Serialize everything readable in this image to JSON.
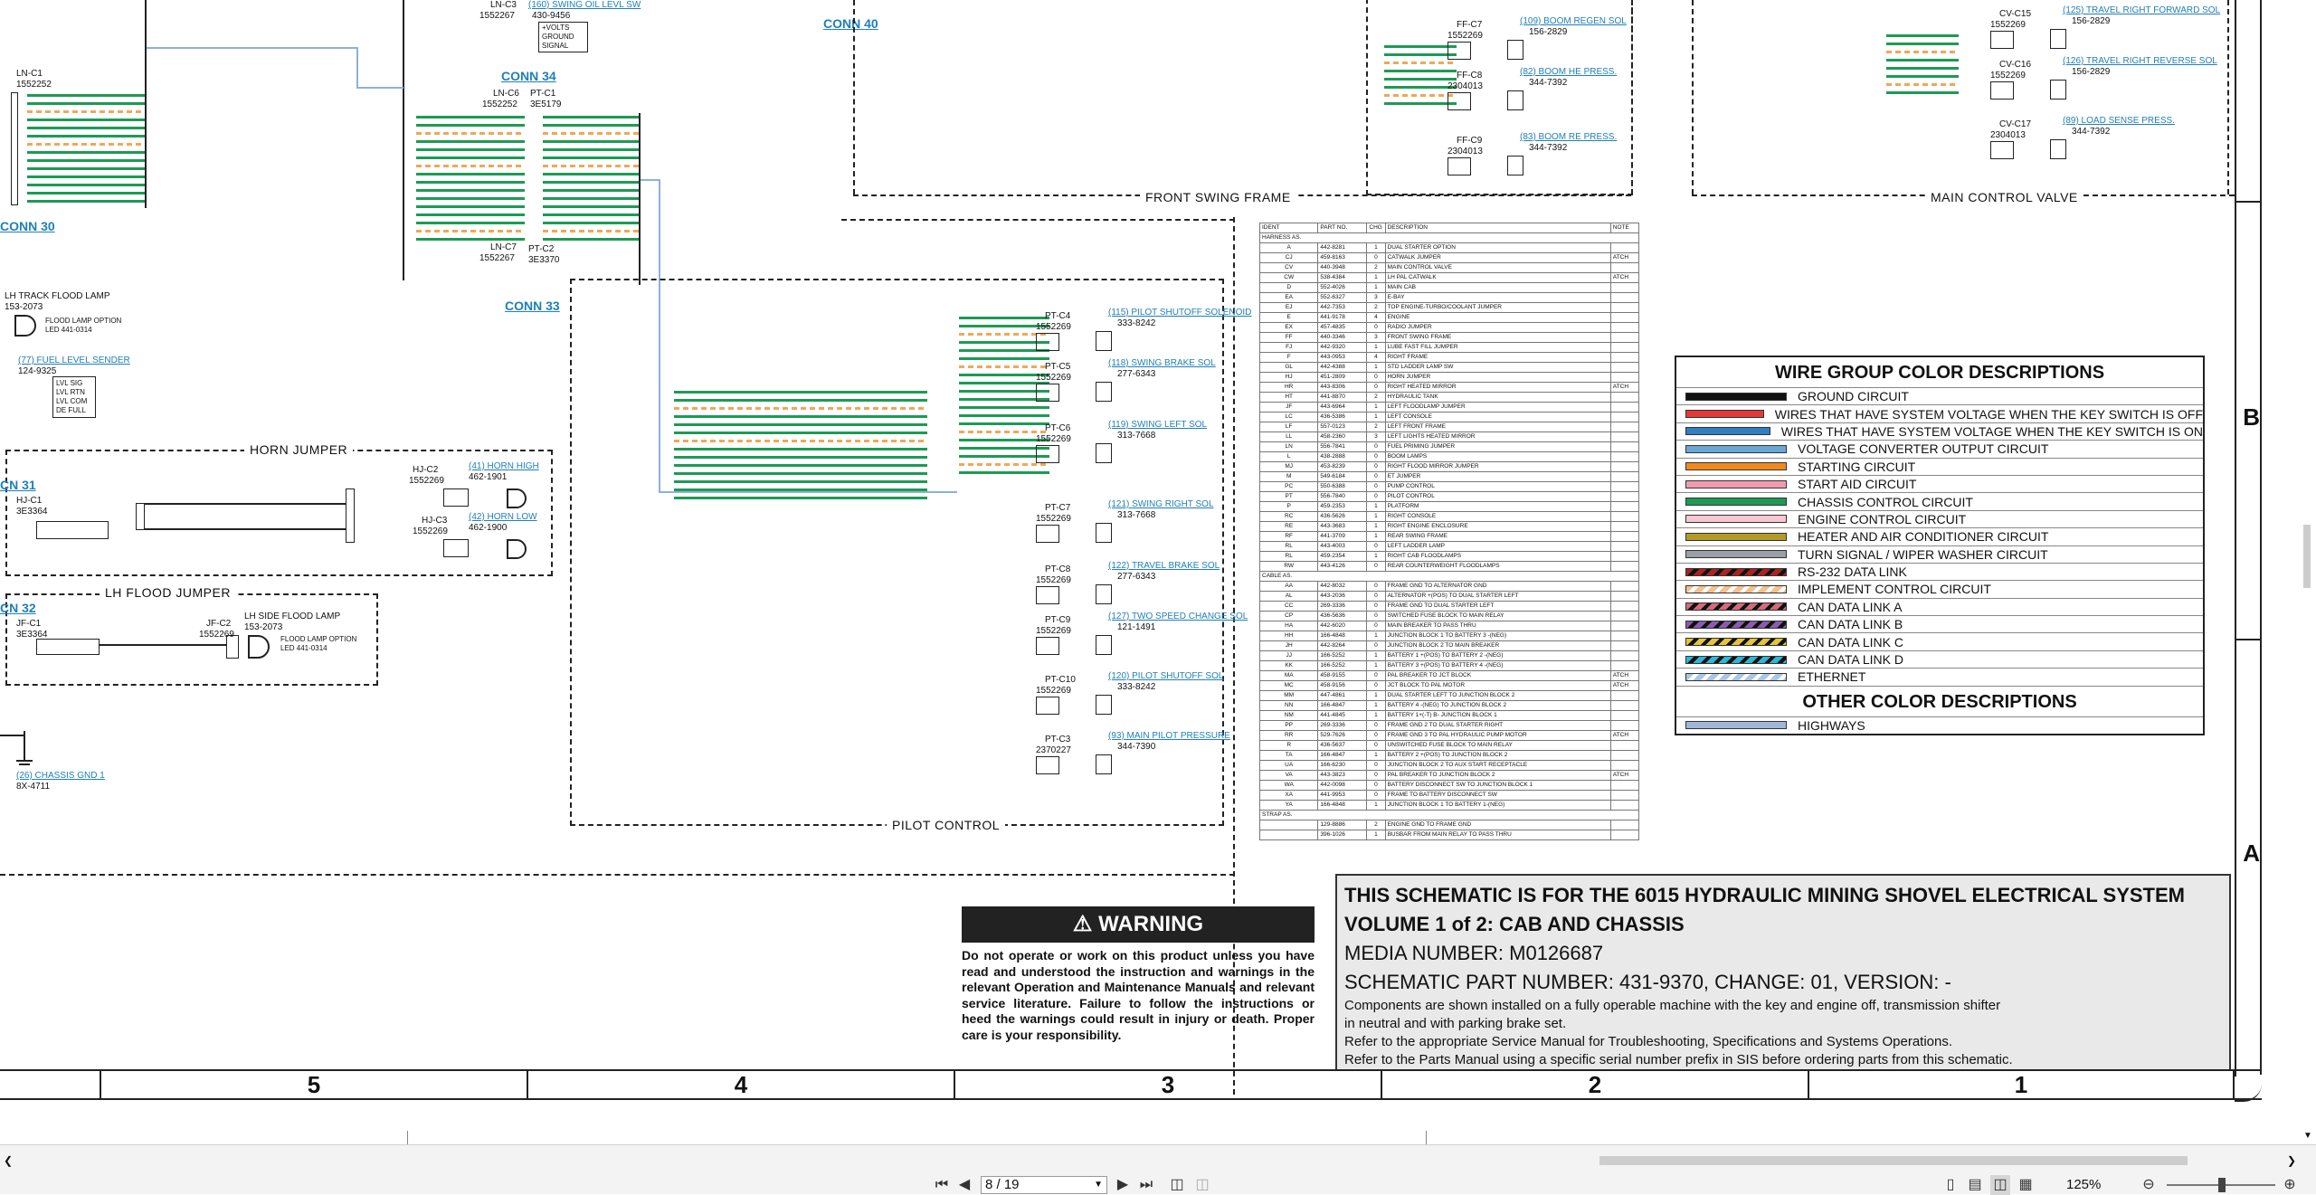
{
  "schematic": {
    "connectors": {
      "conn30": "CONN 30",
      "conn31": "CN 31",
      "conn32": "CN 32",
      "conn33": "CONN 33",
      "conn34": "CONN 34",
      "conn40": "CONN 40"
    },
    "top_left": {
      "lnc1": "LN-C1",
      "lnc1_part": "1552252",
      "lnc3": "LN-C3",
      "lnc3_part": "1552267",
      "swing_oil": "(160) SWING OIL LEVL SW",
      "swing_oil_part": "430-9456",
      "lnc6": "LN-C6",
      "lnc6_part": "1552252",
      "ptc1": "PT-C1",
      "ptc1_part": "3E5179",
      "lnc7": "LN-C7",
      "lnc7_part": "1552267",
      "ptc2": "PT-C2",
      "ptc2_part": "3E3370",
      "swing_oil_pins": [
        "+VOLTS",
        "GROUND",
        "SIGNAL"
      ]
    },
    "left_lamps": {
      "track_lamp": "LH TRACK FLOOD LAMP",
      "track_lamp_part": "153-2073",
      "flood_lamp_option": "FLOOD LAMP OPTION",
      "flood_led": "LED 441-0314",
      "fuel_sender": "(77) FUEL LEVEL SENDER",
      "fuel_sender_part": "124-9325",
      "fuel_pins": [
        "LVL SIG",
        "LVL RTN",
        "LVL COM",
        "DE FULL"
      ]
    },
    "horn": {
      "title": "HORN JUMPER",
      "hjc1": "HJ-C1",
      "hjc1_part": "3E3364",
      "hjc2": "HJ-C2",
      "hjc2_part": "1552269",
      "hjc3": "HJ-C3",
      "hjc3_part": "1552269",
      "horn_high": "(41) HORN HIGH",
      "horn_high_part": "462-1901",
      "horn_low": "(42) HORN LOW",
      "horn_low_part": "462-1900"
    },
    "flood": {
      "title": "LH FLOOD JUMPER",
      "jfc1": "JF-C1",
      "jfc1_part": "3E3364",
      "jfc2": "JF-C2",
      "jfc2_part": "1552269",
      "side_lamp": "LH SIDE FLOOD LAMP",
      "side_lamp_part": "153-2073",
      "option": "FLOOD LAMP OPTION",
      "led": "LED 441-0314",
      "chassis_gnd": "(26) CHASSIS GND 1",
      "chassis_gnd_part": "8X-4711"
    },
    "pilot": {
      "title": "PILOT CONTROL",
      "items": [
        {
          "id": "PT-C4",
          "part": "1552269",
          "name": "(115) PILOT SHUTOFF SOLENOID",
          "num": "333-8242"
        },
        {
          "id": "PT-C5",
          "part": "1552269",
          "name": "(118) SWING BRAKE SOL",
          "num": "277-6343"
        },
        {
          "id": "PT-C6",
          "part": "1552269",
          "name": "(119) SWING LEFT SOL",
          "num": "313-7668"
        },
        {
          "id": "PT-C7",
          "part": "1552269",
          "name": "(121) SWING RIGHT SOL",
          "num": "313-7668"
        },
        {
          "id": "PT-C8",
          "part": "1552269",
          "name": "(122) TRAVEL BRAKE SOL",
          "num": "277-6343"
        },
        {
          "id": "PT-C9",
          "part": "1552269",
          "name": "(127) TWO SPEED CHANGE SOL",
          "num": "121-1491"
        },
        {
          "id": "PT-C10",
          "part": "1552269",
          "name": "(120) PILOT SHUTOFF SOL",
          "num": "333-8242"
        },
        {
          "id": "PT-C3",
          "part": "2370227",
          "name": "(93) MAIN PILOT PRESSURE",
          "num": "344-7390"
        }
      ]
    },
    "front_swing": {
      "title": "FRONT SWING FRAME",
      "items": [
        {
          "id": "FF-C7",
          "part": "1552269",
          "name": "(109) BOOM REGEN SOL",
          "num": "156-2829"
        },
        {
          "id": "FF-C8",
          "part": "2304013",
          "name": "(82) BOOM HE PRESS.",
          "num": "344-7392"
        },
        {
          "id": "FF-C9",
          "part": "2304013",
          "name": "(83) BOOM RE PRESS.",
          "num": "344-7392"
        }
      ]
    },
    "main_valve": {
      "title": "MAIN CONTROL VALVE",
      "items": [
        {
          "id": "CV-C15",
          "part": "1552269",
          "name": "(125) TRAVEL RIGHT FORWARD SOL",
          "num": "156-2829"
        },
        {
          "id": "CV-C16",
          "part": "1552269",
          "name": "(126) TRAVEL RIGHT REVERSE SOL",
          "num": "156-2829"
        },
        {
          "id": "CV-C17",
          "part": "2304013",
          "name": "(89) LOAD SENSE PRESS.",
          "num": "344-7392"
        }
      ]
    }
  },
  "parts_table": {
    "headers": [
      "IDENT",
      "PART NO.",
      "CHG",
      "DESCRIPTION",
      "NOTE"
    ],
    "group_harness": "HARNESS AS.",
    "harness_rows": [
      [
        "A",
        "442-8281",
        "1",
        "DUAL STARTER OPTION",
        ""
      ],
      [
        "CJ",
        "459-8163",
        "0",
        "CATWALK JUMPER",
        "ATCH"
      ],
      [
        "CV",
        "440-3948",
        "2",
        "MAIN CONTROL VALVE",
        ""
      ],
      [
        "CW",
        "538-4384",
        "1",
        "LH PAL CATWALK",
        "ATCH"
      ],
      [
        "D",
        "552-4026",
        "1",
        "MAIN CAB",
        ""
      ],
      [
        "EA",
        "552-6327",
        "3",
        "E-BAY",
        ""
      ],
      [
        "EJ",
        "442-7353",
        "2",
        "TOP ENGINE-TURBO/COOLANT JUMPER",
        ""
      ],
      [
        "E",
        "441-9178",
        "4",
        "ENGINE",
        ""
      ],
      [
        "EX",
        "457-4835",
        "0",
        "RADIO JUMPER",
        ""
      ],
      [
        "FF",
        "440-3346",
        "3",
        "FRONT SWING FRAME",
        ""
      ],
      [
        "FJ",
        "442-9320",
        "1",
        "LUBE FAST FILL JUMPER",
        ""
      ],
      [
        "F",
        "443-0953",
        "4",
        "RIGHT FRAME",
        ""
      ],
      [
        "GL",
        "442-4388",
        "1",
        "STD LADDER LAMP SW",
        ""
      ],
      [
        "HJ",
        "451-2809",
        "0",
        "HORN JUMPER",
        ""
      ],
      [
        "HR",
        "443-8306",
        "0",
        "RIGHT HEATED MIRROR",
        "ATCH"
      ],
      [
        "HT",
        "441-8870",
        "2",
        "HYDRAULIC TANK",
        ""
      ],
      [
        "JF",
        "443-6964",
        "1",
        "LEFT FLOODLAMP JUMPER",
        ""
      ],
      [
        "LC",
        "436-5386",
        "1",
        "LEFT CONSOLE",
        ""
      ],
      [
        "LF",
        "557-0123",
        "2",
        "LEFT FRONT FRAME",
        ""
      ],
      [
        "LL",
        "458-2360",
        "3",
        "LEFT LIGHTS HEATED MIRROR",
        ""
      ],
      [
        "LN",
        "556-7841",
        "0",
        "FUEL PRIMING JUMPER",
        ""
      ],
      [
        "L",
        "438-2888",
        "0",
        "BOOM LAMPS",
        ""
      ],
      [
        "MJ",
        "453-8239",
        "0",
        "RIGHT FLOOD MIRROR JUMPER",
        ""
      ],
      [
        "M",
        "549-6184",
        "0",
        "ET JUMPER",
        ""
      ],
      [
        "PC",
        "550-6388",
        "0",
        "PUMP CONTROL",
        ""
      ],
      [
        "PT",
        "556-7840",
        "0",
        "PILOT CONTROL",
        ""
      ],
      [
        "P",
        "459-2353",
        "1",
        "PLATFORM",
        ""
      ],
      [
        "RC",
        "436-5626",
        "1",
        "RIGHT CONSOLE",
        ""
      ],
      [
        "RE",
        "443-3683",
        "1",
        "RIGHT ENGINE ENCLOSURE",
        ""
      ],
      [
        "RF",
        "441-3709",
        "1",
        "REAR SWING FRAME",
        ""
      ],
      [
        "RL",
        "443-4003",
        "0",
        "LEFT LADDER LAMP",
        ""
      ],
      [
        "RL",
        "459-2354",
        "1",
        "RIGHT CAB FLOODLAMPS",
        ""
      ],
      [
        "RW",
        "443-4126",
        "0",
        "REAR COUNTERWEIGHT FLOODLAMPS",
        ""
      ]
    ],
    "group_cable": "CABLE AS.",
    "cable_rows": [
      [
        "AA",
        "442-8032",
        "0",
        "FRAME GND TO ALTERNATOR GND",
        ""
      ],
      [
        "AL",
        "443-2036",
        "0",
        "ALTERNATOR +(POS) TO DUAL STARTER LEFT",
        ""
      ],
      [
        "CC",
        "269-3336",
        "0",
        "FRAME GND TO DUAL STARTER LEFT",
        ""
      ],
      [
        "CP",
        "436-5636",
        "0",
        "SWITCHED FUSE BLOCK TO MAIN RELAY",
        ""
      ],
      [
        "HA",
        "442-6020",
        "0",
        "MAIN BREAKER TO PASS THRU",
        ""
      ],
      [
        "HH",
        "166-4848",
        "1",
        "JUNCTION BLOCK 1 TO BATTERY 3 -(NEG)",
        ""
      ],
      [
        "JH",
        "442-8264",
        "0",
        "JUNCTION BLOCK 2 TO MAIN BREAKER",
        ""
      ],
      [
        "JJ",
        "166-5252",
        "1",
        "BATTERY 1 +(POS) TO BATTERY 2 -(NEG)",
        ""
      ],
      [
        "KK",
        "166-5252",
        "1",
        "BATTERY 3 +(POS) TO BATTERY 4 -(NEG)",
        ""
      ],
      [
        "MA",
        "458-9155",
        "0",
        "PAL BREAKER TO JCT BLOCK",
        "ATCH"
      ],
      [
        "MC",
        "458-9156",
        "0",
        "JCT BLOCK TO PAL MOTOR",
        "ATCH"
      ],
      [
        "MM",
        "447-4861",
        "1",
        "DUAL STARTER LEFT TO JUNCTION BLOCK 2",
        ""
      ],
      [
        "NN",
        "166-4847",
        "1",
        "BATTERY 4 -(NEG) TO JUNCTION BLOCK 2",
        ""
      ],
      [
        "NM",
        "441-4845",
        "1",
        "BATTERY 1+(-T) B- JUNCTION BLOCK 1",
        ""
      ],
      [
        "PP",
        "269-3336",
        "0",
        "FRAME GND 2 TO DUAL STARTER RIGHT",
        ""
      ],
      [
        "RR",
        "529-7626",
        "0",
        "FRAME GND 3 TO PAL HYDRAULIC PUMP MOTOR",
        "ATCH"
      ],
      [
        "R",
        "436-5637",
        "0",
        "UNSWITCHED FUSE BLOCK TO MAIN RELAY",
        ""
      ],
      [
        "TA",
        "166-4847",
        "1",
        "BATTERY 2 +(POS) TO JUNCTION BLOCK 2",
        ""
      ],
      [
        "UA",
        "166-6230",
        "0",
        "JUNCTION BLOCK 2 TO AUX START RECEPTACLE",
        ""
      ],
      [
        "VA",
        "443-3823",
        "0",
        "PAL BREAKER TO JUNCTION BLOCK 2",
        "ATCH"
      ],
      [
        "WA",
        "442-0098",
        "0",
        "BATTERY DISCONNECT SW TO JUNCTION BLOCK 1",
        ""
      ],
      [
        "XA",
        "441-9953",
        "0",
        "FRAME TO BATTERY DISCONNECT SW",
        ""
      ],
      [
        "YA",
        "166-4848",
        "1",
        "JUNCTION BLOCK 1 TO BATTERY 1-(NEG)",
        ""
      ]
    ],
    "group_strap": "STRAP AS.",
    "strap_rows": [
      [
        "",
        "129-8886",
        "2",
        "ENGINE GND TO FRAME GND",
        ""
      ],
      [
        "",
        "396-1026",
        "1",
        "BUSBAR FROM MAIN RELAY TO PASS THRU",
        ""
      ]
    ]
  },
  "color_descriptions": {
    "title": "WIRE GROUP COLOR DESCRIPTIONS",
    "items": [
      {
        "label": "GROUND CIRCUIT",
        "color": "#111111",
        "pattern": "solid"
      },
      {
        "label": "WIRES THAT HAVE SYSTEM VOLTAGE WHEN THE KEY SWITCH IS OFF",
        "color": "#e53935",
        "pattern": "solid"
      },
      {
        "label": "WIRES THAT HAVE SYSTEM VOLTAGE WHEN THE KEY SWITCH IS ON",
        "color": "#2f7fc1",
        "pattern": "solid"
      },
      {
        "label": "VOLTAGE CONVERTER OUTPUT CIRCUIT",
        "color": "#6aa7d6",
        "pattern": "solid"
      },
      {
        "label": "STARTING CIRCUIT",
        "color": "#f08a1f",
        "pattern": "solid"
      },
      {
        "label": "START AID CIRCUIT",
        "color": "#f29bb0",
        "pattern": "solid"
      },
      {
        "label": "CHASSIS CONTROL CIRCUIT",
        "color": "#1d9a55",
        "pattern": "solid"
      },
      {
        "label": "ENGINE CONTROL CIRCUIT",
        "color": "#f7c6d2",
        "pattern": "solid"
      },
      {
        "label": "HEATER AND AIR CONDITIONER CIRCUIT",
        "color": "#b39b2a",
        "pattern": "solid"
      },
      {
        "label": "TURN SIGNAL / WIPER WASHER CIRCUIT",
        "color": "#9aa0a6",
        "pattern": "solid"
      },
      {
        "label": "RS-232 DATA LINK",
        "color": "#b02020",
        "pattern": "stripe-black"
      },
      {
        "label": "IMPLEMENT CONTROL CIRCUIT",
        "color": "#f5c18a",
        "pattern": "stripe-light"
      },
      {
        "label": "CAN DATA LINK A",
        "color": "#d46a7a",
        "pattern": "stripe-black"
      },
      {
        "label": "CAN DATA LINK B",
        "color": "#8a5bb0",
        "pattern": "stripe-black"
      },
      {
        "label": "CAN DATA LINK C",
        "color": "#e7c23a",
        "pattern": "stripe-black"
      },
      {
        "label": "CAN DATA LINK D",
        "color": "#2bb7d6",
        "pattern": "stripe-black"
      },
      {
        "label": "ETHERNET",
        "color": "#a9c6e8",
        "pattern": "stripe-light"
      }
    ],
    "other_title": "OTHER COLOR DESCRIPTIONS",
    "other_items": [
      {
        "label": "HIGHWAYS",
        "color": "#9fb6d6",
        "pattern": "solid"
      }
    ]
  },
  "warning": {
    "title": "WARNING",
    "body": "Do not operate or work on this product unless you have read and understood the instruction and warnings in the relevant Operation and Maintenance Manuals and relevant service literature. Failure to follow the instructions or heed the warnings could result in injury or death. Proper care is your responsibility."
  },
  "info": {
    "line1": "THIS SCHEMATIC IS FOR THE 6015 HYDRAULIC MINING SHOVEL ELECTRICAL SYSTEM",
    "line2": "VOLUME 1 of 2: CAB AND CHASSIS",
    "line3": "MEDIA NUMBER: M0126687",
    "line4": "SCHEMATIC PART NUMBER: 431-9370, CHANGE: 01, VERSION: -",
    "line5": "Components are shown installed on a fully operable machine with the key and engine off, transmission shifter",
    "line6": "in neutral and with parking brake set.",
    "line7": "Refer to the appropriate Service Manual for Troubleshooting, Specifications and Systems Operations.",
    "line8": "Refer to the Parts Manual using a specific serial number prefix in SIS before ordering parts from this schematic."
  },
  "zones": {
    "columns": [
      "5",
      "4",
      "3",
      "2",
      "1"
    ],
    "rows": [
      "B",
      "A"
    ]
  },
  "viewer": {
    "page_value": "8 / 19",
    "zoom": "125%",
    "icons": [
      "first-page-icon",
      "prev-page-icon",
      "next-page-icon",
      "last-page-icon"
    ]
  }
}
